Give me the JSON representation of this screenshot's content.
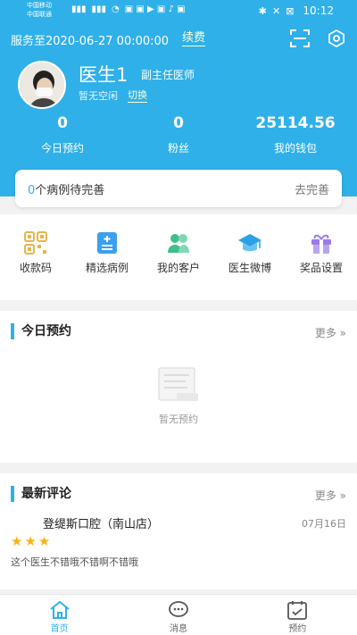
{
  "statusbar": {
    "carrier1": "中国移动",
    "carrier2": "中国联通",
    "battery": "⊠",
    "time": "10:12"
  },
  "header": {
    "service": "服务至2020-06-27 00:00:00",
    "renew": "续费",
    "doctor_name": "医生1",
    "doctor_title": "副主任医师",
    "availability": "暂无空闲",
    "switch": "切换",
    "stats": [
      {
        "value": "0",
        "label": "今日预约"
      },
      {
        "value": "0",
        "label": "粉丝"
      },
      {
        "value": "25114.56",
        "label": "我的钱包"
      }
    ]
  },
  "pending": {
    "count": "0",
    "text": "个病例待完善",
    "action": "去完善"
  },
  "quick": [
    {
      "label": "收款码",
      "icon": "qrcode-icon",
      "color": "#e8b44a"
    },
    {
      "label": "精选病例",
      "icon": "case-list-icon",
      "color": "#3ba0f0"
    },
    {
      "label": "我的客户",
      "icon": "customers-icon",
      "color": "#3dc08a"
    },
    {
      "label": "医生微博",
      "icon": "graduation-cap-icon",
      "color": "#2aa0e6"
    },
    {
      "label": "奖品设置",
      "icon": "gift-icon",
      "color": "#9a7be8"
    }
  ],
  "today": {
    "title": "今日预约",
    "more": "更多",
    "empty": "暂无预约"
  },
  "reviews": {
    "title": "最新评论",
    "more": "更多",
    "clinic": "登缇斯口腔（南山店）",
    "date": "07月16日",
    "stars": 3,
    "text": "这个医生不错哦不错啊不错哦"
  },
  "tabs": [
    {
      "label": "首页",
      "icon": "home-icon"
    },
    {
      "label": "消息",
      "icon": "message-icon"
    },
    {
      "label": "预约",
      "icon": "calendar-check-icon"
    }
  ],
  "colors": {
    "brand": "#2fb0e8",
    "star": "#f5b21b"
  }
}
